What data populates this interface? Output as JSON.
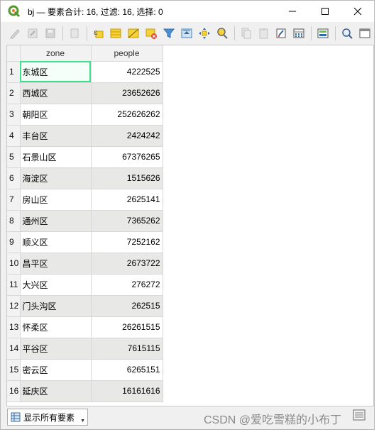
{
  "window": {
    "title": "bj — 要素合计: 16, 过滤: 16, 选择: 0"
  },
  "toolbar": {
    "buttons": [
      "toggle-editing-icon",
      "multi-edit-icon",
      "save-edits-icon",
      "delete-feature-icon",
      "expression-select-icon",
      "select-all-icon",
      "invert-selection-icon",
      "deselect-all-icon",
      "filter-icon",
      "move-selection-top-icon",
      "pan-to-selected-icon",
      "zoom-to-selected-icon",
      "copy-icon",
      "paste-icon",
      "delete-field-icon",
      "field-calculator-icon",
      "conditional-formatting-icon",
      "actions-icon",
      "dock-icon"
    ]
  },
  "table": {
    "headers": [
      "zone",
      "people"
    ],
    "rows": [
      {
        "num": "1",
        "zone": "东城区",
        "people": "4222525"
      },
      {
        "num": "2",
        "zone": "西城区",
        "people": "23652626"
      },
      {
        "num": "3",
        "zone": "朝阳区",
        "people": "252626262"
      },
      {
        "num": "4",
        "zone": "丰台区",
        "people": "2424242"
      },
      {
        "num": "5",
        "zone": "石景山区",
        "people": "67376265"
      },
      {
        "num": "6",
        "zone": "海淀区",
        "people": "1515626"
      },
      {
        "num": "7",
        "zone": "房山区",
        "people": "2625141"
      },
      {
        "num": "8",
        "zone": "通州区",
        "people": "7365262"
      },
      {
        "num": "9",
        "zone": "顺义区",
        "people": "7252162"
      },
      {
        "num": "10",
        "zone": "昌平区",
        "people": "2673722"
      },
      {
        "num": "11",
        "zone": "大兴区",
        "people": "276272"
      },
      {
        "num": "12",
        "zone": "门头沟区",
        "people": "262515"
      },
      {
        "num": "13",
        "zone": "怀柔区",
        "people": "26261515"
      },
      {
        "num": "14",
        "zone": "平谷区",
        "people": "7615115"
      },
      {
        "num": "15",
        "zone": "密云区",
        "people": "6265151"
      },
      {
        "num": "16",
        "zone": "延庆区",
        "people": "16161616"
      }
    ]
  },
  "bottombar": {
    "filter_label": "显示所有要素"
  },
  "watermark": "CSDN @爱吃雪糕的小布丁",
  "colors": {
    "selection_outline": "#3fe08c",
    "alt_row": "#e8e8e6",
    "header_bg": "#f2f2f2"
  }
}
